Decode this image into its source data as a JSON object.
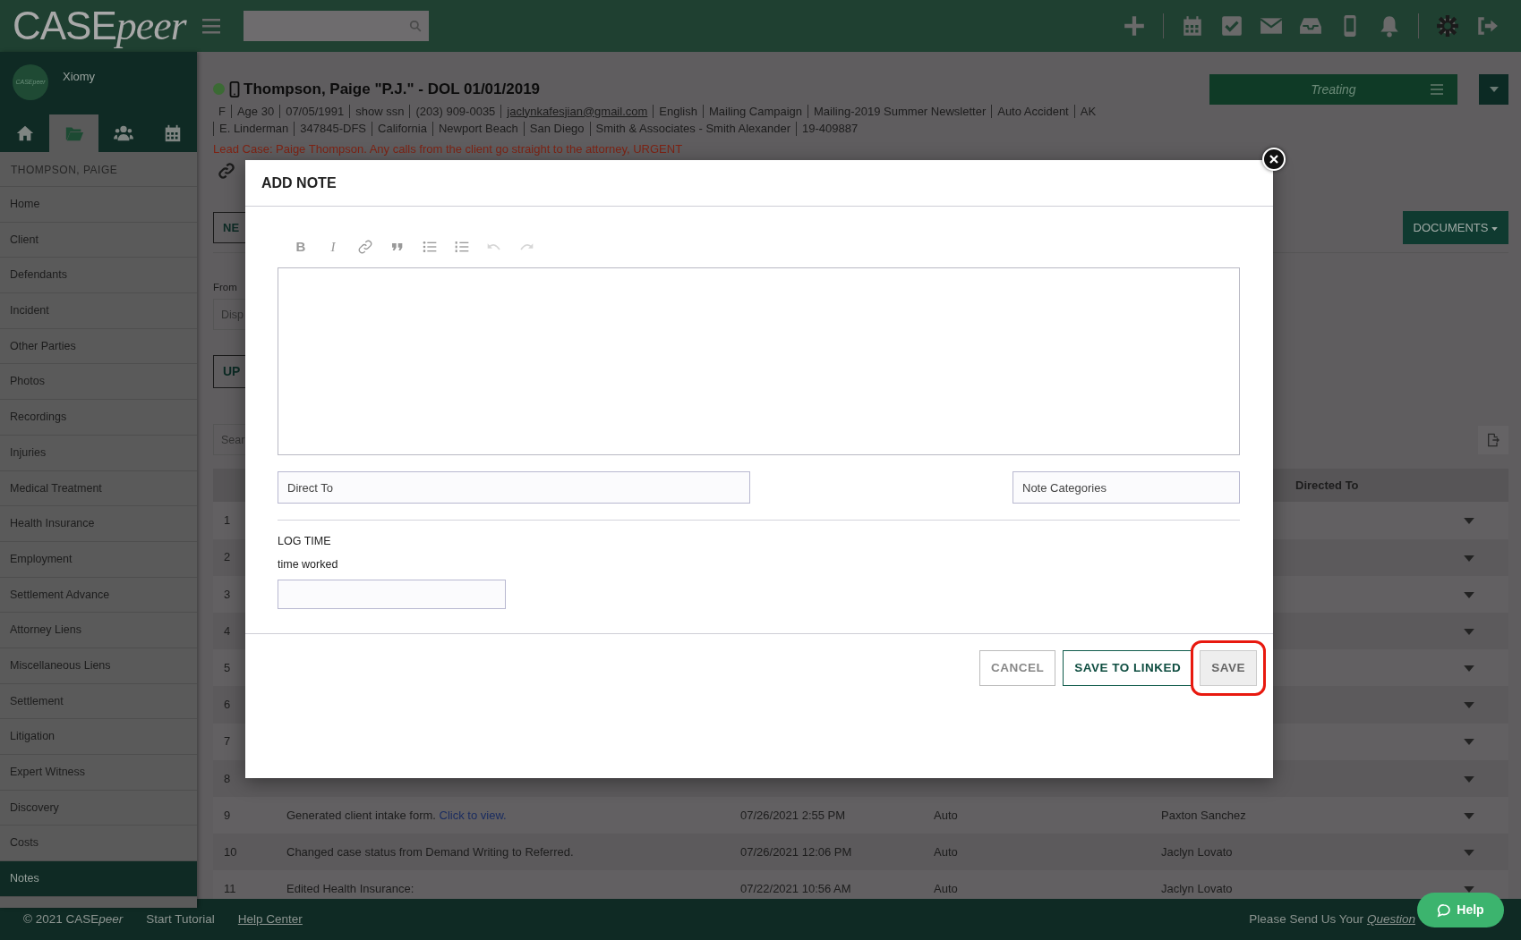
{
  "header": {
    "logo_main": "CASE",
    "logo_italic": "peer",
    "icon_groups": [
      [
        {
          "kind": "plus"
        }
      ],
      [
        {
          "kind": "calendar"
        },
        {
          "kind": "tasks"
        },
        {
          "kind": "mail"
        },
        {
          "kind": "inbox"
        },
        {
          "kind": "phone"
        },
        {
          "kind": "bell"
        }
      ],
      [
        {
          "kind": "gear"
        },
        {
          "kind": "logout"
        }
      ]
    ]
  },
  "sidebar": {
    "user": {
      "name": "Xiomy",
      "avatar_logo": "CASEpeer"
    },
    "tabs": [
      {
        "kind": "home",
        "selected": false
      },
      {
        "kind": "folder",
        "selected": true
      },
      {
        "kind": "people",
        "selected": false
      },
      {
        "kind": "calendar",
        "selected": false
      }
    ],
    "section_title": "THOMPSON, PAIGE",
    "items": [
      {
        "label": "Home",
        "selected": false
      },
      {
        "label": "Client",
        "selected": false
      },
      {
        "label": "Defendants",
        "selected": false
      },
      {
        "label": "Incident",
        "selected": false
      },
      {
        "label": "Other Parties",
        "selected": false
      },
      {
        "label": "Photos",
        "selected": false
      },
      {
        "label": "Recordings",
        "selected": false
      },
      {
        "label": "Injuries",
        "selected": false
      },
      {
        "label": "Medical Treatment",
        "selected": false
      },
      {
        "label": "Health Insurance",
        "selected": false
      },
      {
        "label": "Employment",
        "selected": false
      },
      {
        "label": "Settlement Advance",
        "selected": false
      },
      {
        "label": "Attorney Liens",
        "selected": false
      },
      {
        "label": "Miscellaneous Liens",
        "selected": false
      },
      {
        "label": "Settlement",
        "selected": false
      },
      {
        "label": "Litigation",
        "selected": false
      },
      {
        "label": "Expert Witness",
        "selected": false
      },
      {
        "label": "Discovery",
        "selected": false
      },
      {
        "label": "Costs",
        "selected": false
      },
      {
        "label": "Notes",
        "selected": true
      }
    ]
  },
  "case": {
    "title": "Thompson, Paige \"P.J.\" - DOL 01/01/2019",
    "info_lines": [
      [
        {
          "text": "F"
        },
        {
          "text": "Age 30"
        },
        {
          "text": "07/05/1991"
        },
        {
          "text": "show ssn"
        },
        {
          "text": "(203) 909-0035"
        },
        {
          "text": "jaclynkafesjian@gmail.com",
          "kind": "link"
        },
        {
          "text": "English"
        },
        {
          "text": "Mailing Campaign"
        },
        {
          "text": "Mailing-2019 Summer Newsletter"
        },
        {
          "text": "Auto Accident"
        },
        {
          "text": "AK"
        }
      ],
      [
        {
          "text": "E. Linderman"
        },
        {
          "text": "347845-DFS"
        },
        {
          "text": "California"
        },
        {
          "text": "Newport Beach"
        },
        {
          "text": "San Diego"
        },
        {
          "text": "Smith & Associates - Smith Alexander"
        },
        {
          "text": "19-409887"
        }
      ]
    ],
    "lead_note": "Lead Case: Paige Thompson. Any calls from the client go straight to the attorney, URGENT",
    "status_button": "Treating"
  },
  "toolbar": {
    "tab_partial": "NE",
    "documents_button": "DOCUMENTS"
  },
  "filters": {
    "from_label": "From",
    "from_placeholder": "Disp",
    "upload_partial": "UP",
    "search_placeholder": "Sear"
  },
  "table": {
    "visible_column": "Directed To",
    "rows": [
      {
        "number": "1"
      },
      {
        "number": "2"
      },
      {
        "number": "3"
      },
      {
        "number": "4"
      },
      {
        "number": "5"
      },
      {
        "number": "6"
      },
      {
        "number": "7"
      },
      {
        "number": "8"
      },
      {
        "number": "9",
        "description": "Generated client intake form.",
        "link": "Click to view.",
        "date": "07/26/2021 2:55 PM",
        "type": "Auto",
        "directed_to": "Paxton Sanchez"
      },
      {
        "number": "10",
        "description": "Changed case status from Demand Writing to Referred.",
        "date": "07/26/2021 12:06 PM",
        "type": "Auto",
        "directed_to": "Jaclyn Lovato"
      },
      {
        "number": "11",
        "description": "Edited Health Insurance:",
        "date": "07/22/2021 10:56 AM",
        "type": "Auto",
        "directed_to": "Jaclyn Lovato"
      }
    ]
  },
  "modal": {
    "title": "ADD NOTE",
    "toolbar": [
      {
        "kind": "bold",
        "label": "B",
        "disabled": false
      },
      {
        "kind": "italic",
        "label": "I",
        "disabled": false
      },
      {
        "kind": "link",
        "disabled": false
      },
      {
        "kind": "quote",
        "disabled": false
      },
      {
        "kind": "bullets",
        "disabled": false
      },
      {
        "kind": "numbers",
        "disabled": false
      },
      {
        "kind": "undo",
        "disabled": true
      },
      {
        "kind": "redo",
        "disabled": true
      }
    ],
    "direct_to_placeholder": "Direct To",
    "categories_placeholder": "Note Categories",
    "log_time_heading": "LOG TIME",
    "time_label": "time worked",
    "buttons": [
      {
        "kind": "cancel",
        "label": "CANCEL",
        "highlighted": false
      },
      {
        "kind": "linked",
        "label": "SAVE TO LINKED",
        "highlighted": false
      },
      {
        "kind": "save",
        "label": "SAVE",
        "highlighted": true
      }
    ]
  },
  "footer": {
    "copyright": "© 2021 CASE",
    "copyright_italic": "peer",
    "links": [
      {
        "label": "Start Tutorial",
        "underlined": false
      },
      {
        "label": "Help Center",
        "underlined": true
      }
    ],
    "feedback": "Please Send Us Your",
    "feedback_link": "Question",
    "help_button": "Help"
  }
}
